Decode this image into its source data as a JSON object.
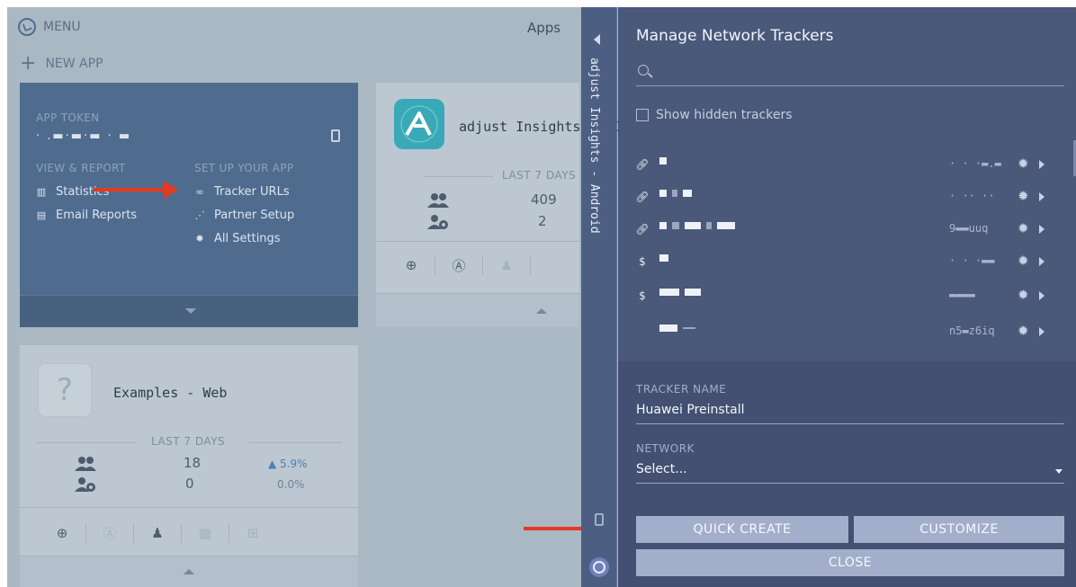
{
  "header": {
    "menu_label": "MENU",
    "new_app_label": "NEW APP",
    "apps_title": "Apps"
  },
  "app_card_android": {
    "token_label": "APP TOKEN",
    "token_value": "· .▬·▬·▬ · ▬",
    "view_report_label": "VIEW & REPORT",
    "setup_label": "SET UP YOUR APP",
    "statistics": "Statistics",
    "email_reports": "Email Reports",
    "tracker_urls": "Tracker URLs",
    "partner_setup": "Partner Setup",
    "all_settings": "All Settings"
  },
  "app_card_ios": {
    "name": "adjust Insights - iO",
    "period": "LAST 7 DAYS",
    "installs": "409",
    "revenue_users": "2"
  },
  "app_card_web": {
    "name": "Examples - Web",
    "period": "LAST 7 DAYS",
    "installs": "18",
    "installs_change": "▲ 5.9%",
    "revenue_users": "0",
    "revenue_change": "0.0%"
  },
  "side_strip": {
    "app_title": "adjust Insights - Android"
  },
  "panel": {
    "title": "Manage Network Trackers",
    "search_placeholder": "",
    "show_hidden_label": "Show hidden trackers",
    "trackers": [
      {
        "type_icon": "link-icon",
        "token": "· · ·▬.▬"
      },
      {
        "type_icon": "link-icon",
        "token": "· ·· ·· .  ·"
      },
      {
        "type_icon": "link-icon",
        "token": "9▬▬uuq"
      },
      {
        "type_icon": "revenue-icon",
        "token": "· · ·▬▬"
      },
      {
        "type_icon": "revenue-icon",
        "token": "▬▬▬▬"
      },
      {
        "type_icon": "none",
        "token": "n5▬z6iq"
      }
    ],
    "tracker_name_label": "TRACKER NAME",
    "tracker_name_value": "Huawei Preinstall",
    "network_label": "NETWORK",
    "network_value": "Select...",
    "quick_create_label": "QUICK CREATE",
    "customize_label": "CUSTOMIZE",
    "close_label": "CLOSE"
  },
  "colors": {
    "panel_bg": "#4a587a",
    "strip_bg": "#4c5f83",
    "arrow": "#e23b22",
    "button_bg": "#a3aecb"
  }
}
